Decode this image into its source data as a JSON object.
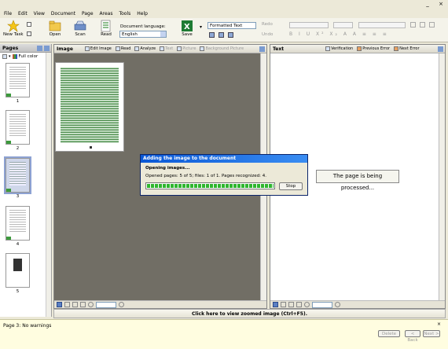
{
  "menu": [
    "File",
    "Edit",
    "View",
    "Document",
    "Page",
    "Areas",
    "Tools",
    "Help"
  ],
  "toolbar": {
    "new_task": "New Task",
    "open": "Open",
    "scan": "Scan",
    "read": "Read",
    "doc_language_label": "Document language:",
    "doc_language_value": "English",
    "save": "Save",
    "save_format": "Formatted Text",
    "redo": "Redo",
    "undo": "Undo"
  },
  "pages_panel": {
    "title": "Pages",
    "color_mode": "Full color",
    "thumbnails": [
      "1",
      "2",
      "3",
      "4",
      "5"
    ]
  },
  "image_panel": {
    "title": "Image",
    "tools": [
      "Edit Image",
      "Read",
      "Analyze",
      "Text",
      "Picture",
      "Background Picture"
    ]
  },
  "text_panel": {
    "title": "Text",
    "tools": [
      "Verification",
      "Previous Error",
      "Next Error"
    ],
    "processing_message": "The page is being processed..."
  },
  "dialog": {
    "title": "Adding the image to the document",
    "heading": "Opening images...",
    "status": "Opened pages: 5 of 5; files: 1 of 1. Pages recognized: 4.",
    "stop": "Stop",
    "progress": 1.0
  },
  "zoom_bar": "Click here to view zoomed image (Ctrl+F5).",
  "status_bar": {
    "page": "Page 3:",
    "message": "No warnings",
    "delete": "Delete",
    "back": "< Back",
    "next": "Next >"
  }
}
